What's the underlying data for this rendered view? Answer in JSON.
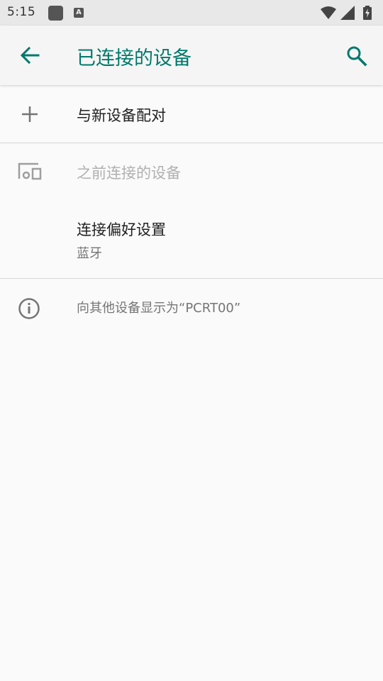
{
  "status_bar": {
    "time": "5:15",
    "icons": [
      "notification-square-icon",
      "notification-a-icon",
      "wifi-icon",
      "signal-icon",
      "battery-icon"
    ],
    "notif_letter": "A"
  },
  "toolbar": {
    "title": "已连接的设备",
    "accent_color": "#00796b"
  },
  "items": {
    "pair_new": "与新设备配对",
    "previously_connected": "之前连接的设备",
    "connection_prefs_title": "连接偏好设置",
    "connection_prefs_subtitle": "蓝牙",
    "visible_as": "向其他设备显示为“PCRT00”"
  }
}
